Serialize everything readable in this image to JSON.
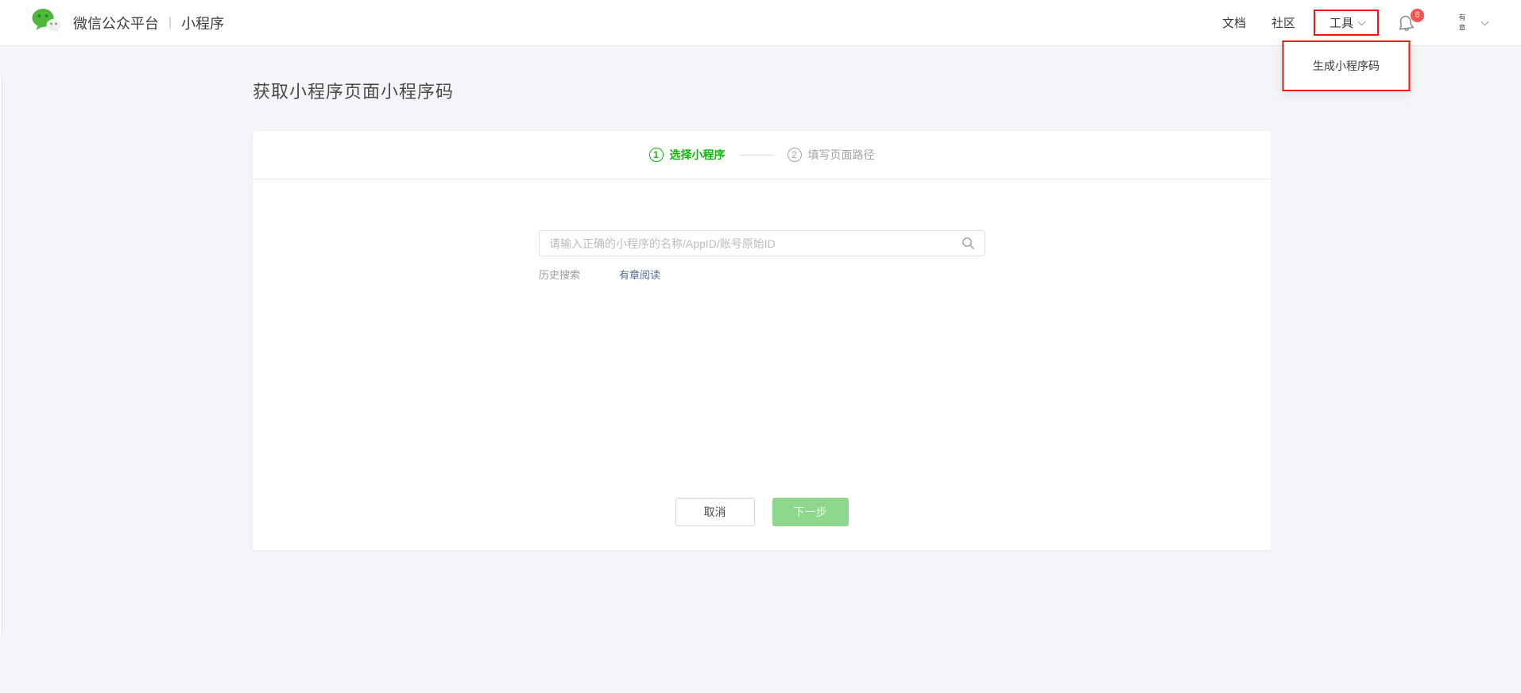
{
  "header": {
    "brand": {
      "platform": "微信公众平台",
      "separator": "|",
      "product": "小程序"
    },
    "nav": {
      "docs": "文档",
      "community": "社区",
      "tools": "工具"
    },
    "notification_badge": "6",
    "avatar_alt_line1": "有",
    "avatar_alt_line2": "章"
  },
  "tools_dropdown": {
    "generate_code": "生成小程序码"
  },
  "page": {
    "title": "获取小程序页面小程序码"
  },
  "stepper": {
    "steps": [
      {
        "number": "1",
        "label": "选择小程序",
        "state": "active"
      },
      {
        "number": "2",
        "label": "填写页面路径",
        "state": "inactive"
      }
    ]
  },
  "search": {
    "placeholder": "请输入正确的小程序的名称/AppID/账号原始ID",
    "value": ""
  },
  "history": {
    "label": "历史搜索",
    "item1": "有章阅读"
  },
  "actions": {
    "cancel": "取消",
    "next": "下一步",
    "next_state": "disabled"
  },
  "colors": {
    "accent_green": "#09bb07",
    "disabled_green": "#8ed88e",
    "link_blue": "#576b95",
    "badge_red": "#fa5151",
    "annotation_red": "#f01414",
    "background": "#f4f5f8"
  }
}
